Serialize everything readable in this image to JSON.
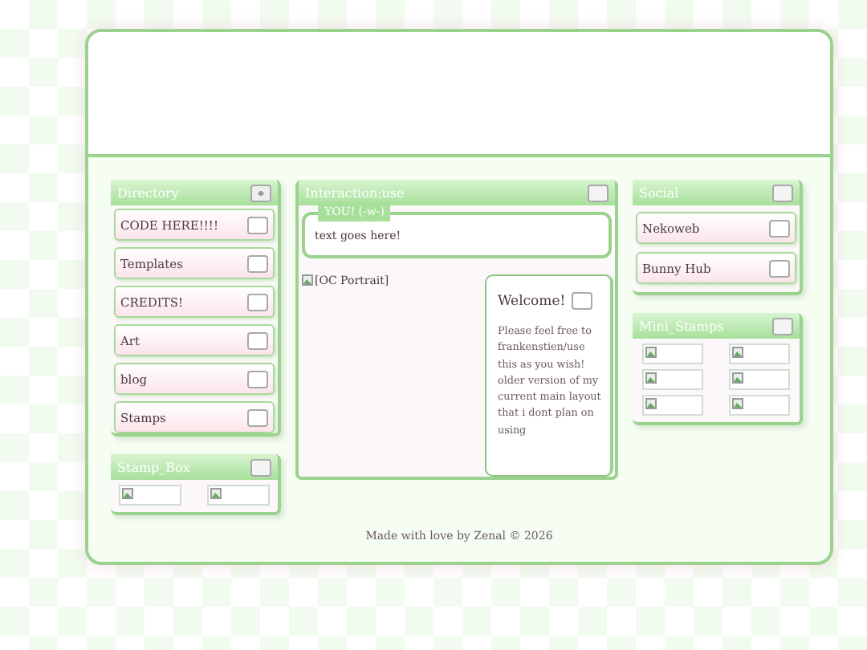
{
  "directory": {
    "title": "Directory",
    "items": [
      {
        "label": "CODE HERE!!!!"
      },
      {
        "label": "Templates"
      },
      {
        "label": "CREDITS!"
      },
      {
        "label": "Art"
      },
      {
        "label": "blog"
      },
      {
        "label": "Stamps"
      }
    ]
  },
  "stamp_box": {
    "title": "Stamp_Box",
    "images": [
      {
        "kind": "broken"
      },
      {
        "kind": "broken"
      }
    ]
  },
  "interaction": {
    "title": "Interaction:use",
    "tag": "YOU! (-w-)",
    "text": "text goes here!"
  },
  "portrait": {
    "alt": "[OC Portrait]"
  },
  "welcome": {
    "title": "Welcome!",
    "body": "Please feel free to frankenstien/use this as you wish! older version of my current main layout that i dont plan on using"
  },
  "social": {
    "title": "Social",
    "items": [
      {
        "label": "Nekoweb"
      },
      {
        "label": "Bunny Hub"
      }
    ]
  },
  "mini": {
    "title": "Mini_Stamps",
    "images": [
      {
        "kind": "broken"
      },
      {
        "kind": "broken"
      },
      {
        "kind": "broken"
      },
      {
        "kind": "broken"
      },
      {
        "kind": "broken"
      },
      {
        "kind": "broken"
      }
    ]
  },
  "footer": "Made with love by Zenal © 2026"
}
